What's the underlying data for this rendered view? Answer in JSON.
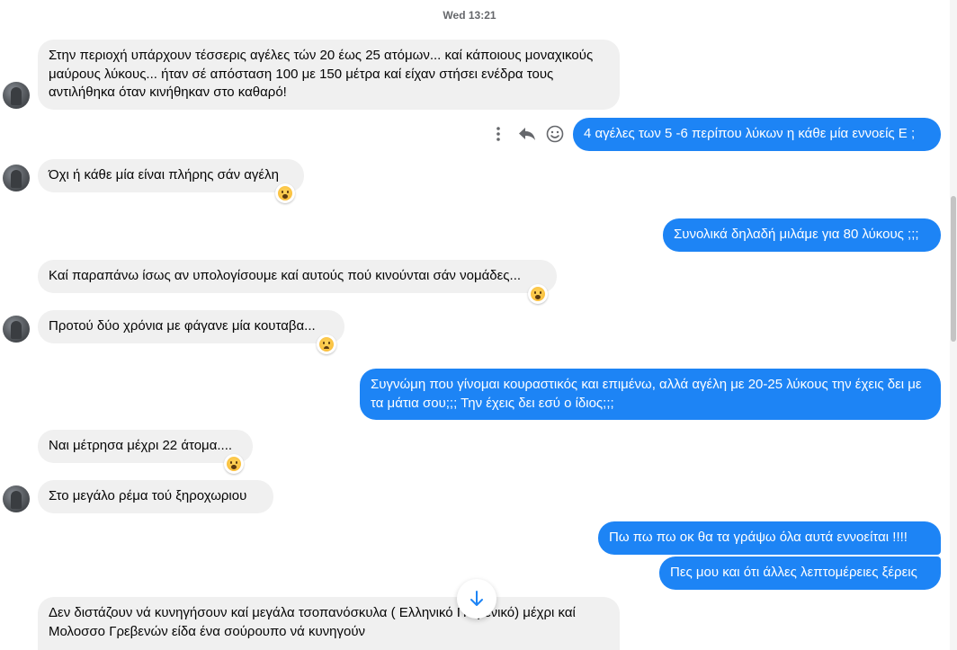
{
  "thread": {
    "timestamp": "Wed 13:21",
    "messages": [
      {
        "direction": "in",
        "text": "Στην περιοχή υπάρχουν τέσσερις αγέλες τών 20 έως 25 ατόμων... καί κάποιους μοναχικούς μαύρους λύκους... ήταν σέ απόσταση 100 με 150 μέτρα καί είχαν στήσει ενέδρα τους αντιλήθηκα όταν κινήθηκαν στο καθαρό!"
      },
      {
        "direction": "out",
        "text": "4 αγέλες των 5 -6 περίπου λύκων η κάθε μία εννοείς Ε ;"
      },
      {
        "direction": "in",
        "text": "Όχι ή κάθε μία είναι πλήρης σάν αγέλη",
        "reaction": "wow"
      },
      {
        "direction": "out",
        "text": "Συνολικά δηλαδή μιλάμε για 80 λύκους ;;;"
      },
      {
        "direction": "in",
        "text": "Καί παραπάνω ίσως αν υπολογίσουμε καί αυτούς πού κινούνται σάν νομάδες...",
        "reaction": "wow"
      },
      {
        "direction": "in",
        "text": "Προτού δύο χρόνια με φάγανε μία κουταβα...",
        "reaction": "sad"
      },
      {
        "direction": "out",
        "text": "Συγνώμη που γίνομαι κουραστικός και επιμένω, αλλά αγέλη με 20-25 λύκους την έχεις δει με τα μάτια σου;;; Την έχεις δει εσύ ο ίδιος;;;"
      },
      {
        "direction": "in",
        "text": "Ναι μέτρησα μέχρι 22 άτομα....",
        "reaction": "wow"
      },
      {
        "direction": "in",
        "text": "Στο μεγάλο ρέμα τού ξηροχωριου"
      },
      {
        "direction": "out",
        "text": "Πω πω πω οκ θα τα γράψω όλα αυτά εννοείται !!!!"
      },
      {
        "direction": "out",
        "text": "Πες μου και ότι άλλες λεπτομέρειες ξέρεις"
      },
      {
        "direction": "in",
        "text": "Δεν διστάζουν νά κυνηγήσουν καί μεγάλα τσοπανόσκυλα ( Ελληνικό Ποιμενικό) μέχρι καί Μολοσσο Γρεβενών είδα ένα σούρουπο νά κυνηγούν"
      }
    ]
  },
  "icons": {
    "message_actions": [
      "more-options-icon",
      "reply-icon",
      "react-emoji-icon"
    ],
    "scroll_down": "arrow-down-icon"
  },
  "colors": {
    "outgoing_bubble": "#1d84f5",
    "incoming_bubble": "#f0f0f0",
    "timestamp_text": "#65676b"
  }
}
